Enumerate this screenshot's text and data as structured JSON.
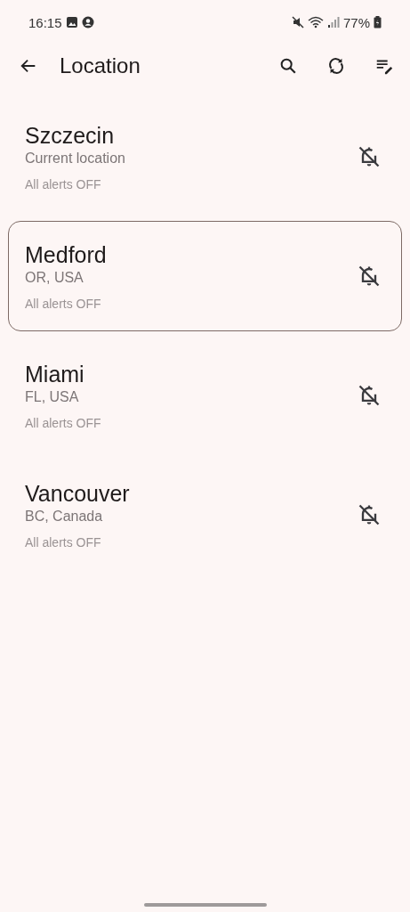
{
  "status_bar": {
    "time": "16:15",
    "battery": "77%"
  },
  "app_bar": {
    "title": "Location"
  },
  "locations": [
    {
      "name": "Szczecin",
      "region": "Current location",
      "alerts": "All alerts OFF",
      "selected": false
    },
    {
      "name": "Medford",
      "region": "OR, USA",
      "alerts": "All alerts OFF",
      "selected": true
    },
    {
      "name": "Miami",
      "region": "FL, USA",
      "alerts": "All alerts OFF",
      "selected": false
    },
    {
      "name": "Vancouver",
      "region": "BC, Canada",
      "alerts": "All alerts OFF",
      "selected": false
    }
  ]
}
